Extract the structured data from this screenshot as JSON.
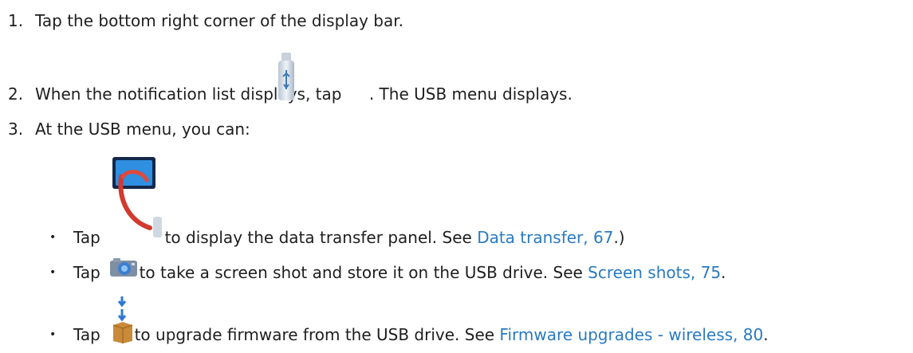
{
  "steps": [
    {
      "num": "1.",
      "text": "Tap the bottom right corner of the display bar."
    },
    {
      "num": "2.",
      "before": "When the notification list displays, tap ",
      "after": ". The USB menu displays."
    },
    {
      "num": "3.",
      "text": "At the USB menu, you can:"
    }
  ],
  "bullets": [
    {
      "bullet": "•",
      "before": "Tap ",
      "icon": "data-transfer-icon",
      "mid": " to display the data transfer panel. See ",
      "link": "Data transfer, 67",
      "after": ".)"
    },
    {
      "bullet": "•",
      "before": "Tap ",
      "icon": "camera-icon",
      "mid": " to take a screen shot and store it on the USB drive. See ",
      "link": "Screen shots, 75",
      "after": "."
    },
    {
      "bullet": "•",
      "before": "Tap ",
      "icon": "firmware-upgrade-box-icon",
      "mid": " to upgrade firmware from the USB drive. See ",
      "link": "Firmware upgrades - wireless, 80",
      "after": "."
    }
  ],
  "colors": {
    "text": "#1e1e1e",
    "link": "#2a7ac0"
  }
}
